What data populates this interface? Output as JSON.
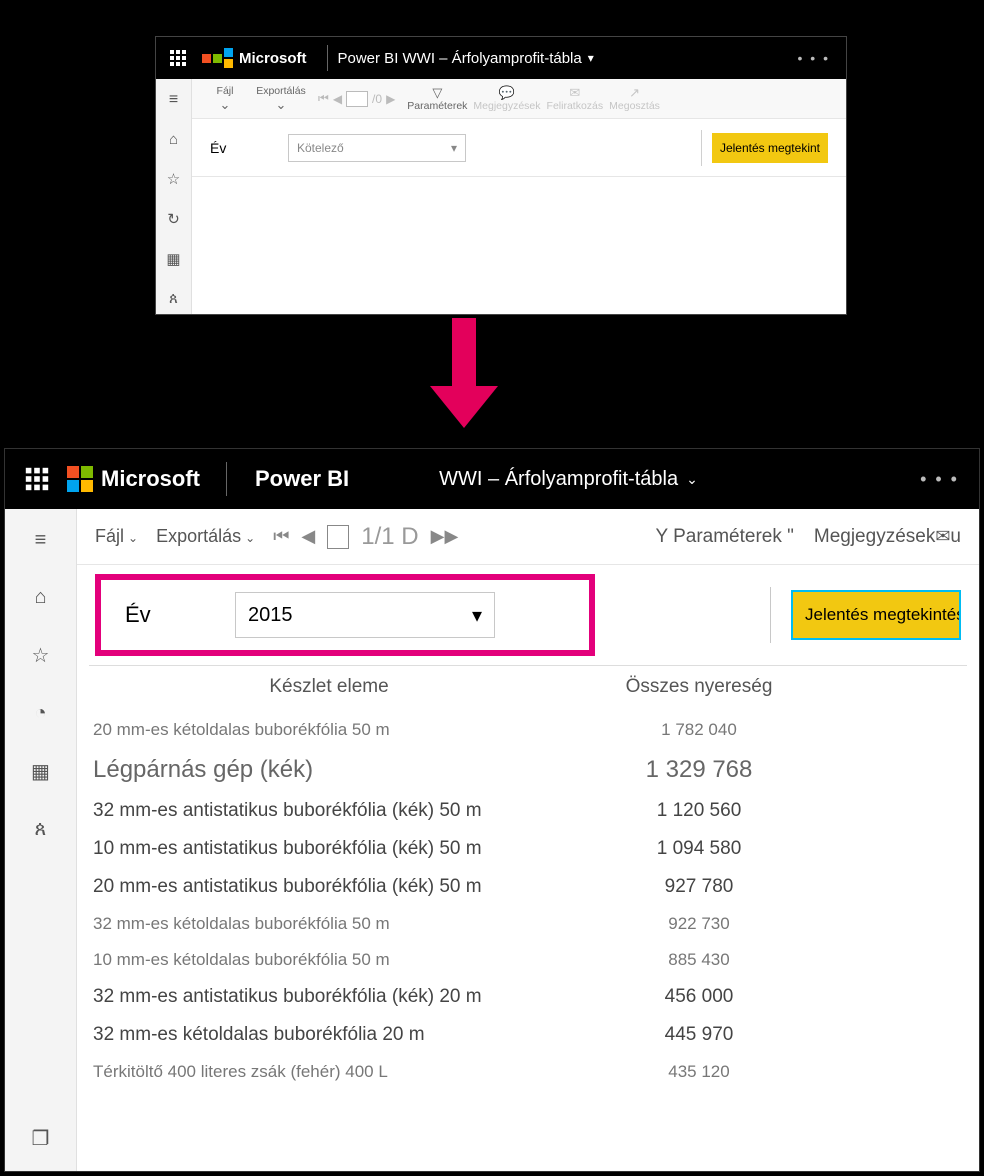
{
  "brand": {
    "ms": "Microsoft",
    "pbi": "Power BI"
  },
  "top": {
    "title": "Power BI WWI – Árfolyamprofit-tábla",
    "toolbar": {
      "file": "Fájl",
      "export": "Exportálás",
      "pageTotal": "/0",
      "params": "Paraméterek",
      "comments": "Megjegyzések",
      "subscribe": "Feliratkozás",
      "share": "Megosztás"
    },
    "param": {
      "label": "Év",
      "placeholder": "Kötelező"
    },
    "button": "Jelentés megtekint"
  },
  "bottom": {
    "title": "WWI – Árfolyamprofit-tábla",
    "toolbar": {
      "file": "Fájl",
      "export": "Exportálás",
      "paging": "1/1 D",
      "params": "Y Paraméterek \"",
      "comments": "Megjegyzések",
      "commentSuffix": "u"
    },
    "param": {
      "label": "Év",
      "value": "2015"
    },
    "button": "Jelentés megtekintése",
    "table": {
      "col1": "Készlet eleme",
      "col2": "Összes nyereség",
      "rows": [
        {
          "n": "20 mm-es kétoldalas buborékfólia 50 m",
          "v": "1 782 040",
          "cls": "plain"
        },
        {
          "n": "Légpárnás gép (kék)",
          "v": "1 329 768",
          "cls": "big"
        },
        {
          "n": "32 mm-es antistatikus buborékfólia (kék) 50 m",
          "v": "1 120 560",
          "cls": ""
        },
        {
          "n": "10 mm-es antistatikus buborékfólia (kék) 50 m",
          "v": "1 094 580",
          "cls": ""
        },
        {
          "n": "20 mm-es antistatikus buborékfólia (kék) 50 m",
          "v": "927 780",
          "cls": ""
        },
        {
          "n": "32 mm-es kétoldalas buborékfólia 50 m",
          "v": "922 730",
          "cls": "plain"
        },
        {
          "n": "10 mm-es kétoldalas buborékfólia 50 m",
          "v": "885 430",
          "cls": "plain"
        },
        {
          "n": "32 mm-es antistatikus buborékfólia (kék) 20 m",
          "v": "456 000",
          "cls": ""
        },
        {
          "n": "32 mm-es kétoldalas buborékfólia 20 m",
          "v": "445 970",
          "cls": ""
        },
        {
          "n": "Térkitöltő 400 literes zsák (fehér) 400 L",
          "v": "435 120",
          "cls": "plain"
        }
      ]
    }
  }
}
